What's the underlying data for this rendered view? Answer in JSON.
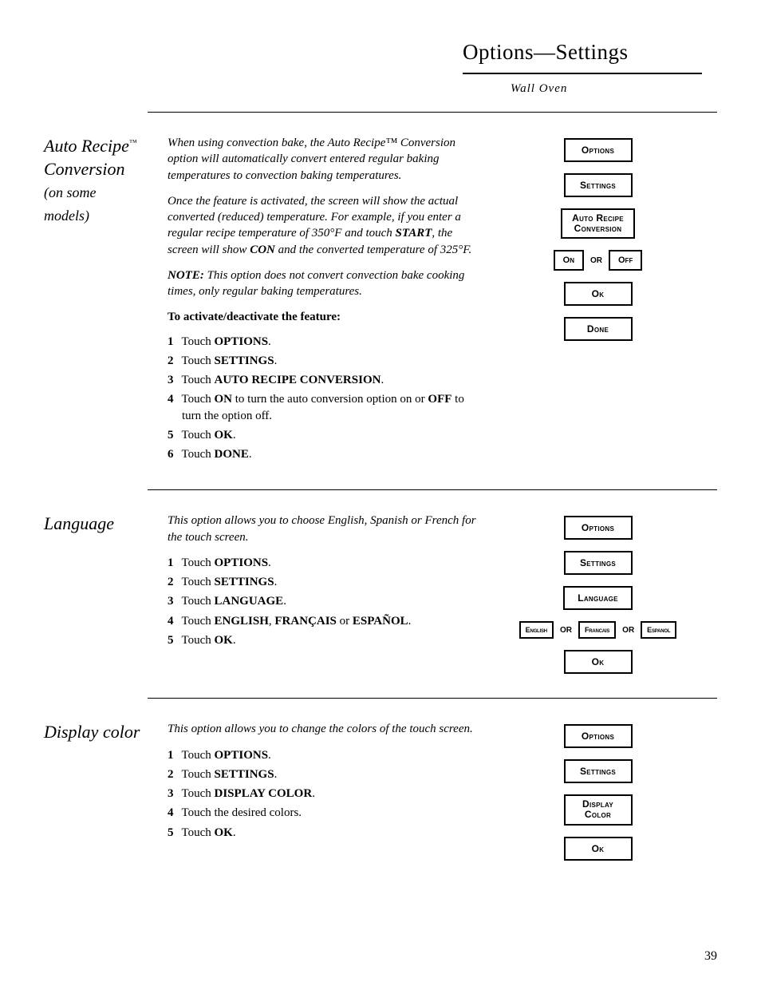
{
  "header": {
    "title": "Options—Settings",
    "subtitle": "Wall Oven"
  },
  "page_number": 39,
  "labels": {
    "options": "Options",
    "settings": "Settings",
    "ok": "Ok",
    "done": "Done",
    "or": "or",
    "auto_recipe_line1": "Auto Recipe",
    "auto_recipe_line2": "Conversion",
    "on": "On",
    "off": "Off",
    "language": "Language",
    "english": "English",
    "francais": "Francais",
    "espanol": "Espanol",
    "display_line1": "Display",
    "display_line2": "Color"
  },
  "section1": {
    "title_l1": "Auto Recipe",
    "title_tm": "™",
    "title_l2": "Conversion",
    "title_l3": "(on some",
    "title_l4": "models)",
    "p1": "When using convection bake, the Auto Recipe™ Conversion option will automatically convert entered regular baking temperatures to convection baking temperatures.",
    "p2a": "Once the feature is activated, the screen will show the actual converted (reduced) temperature. For example, if you enter a regular recipe temperature of 350°F and touch ",
    "p2b": "START",
    "p2c": ", the screen will show ",
    "p2d": "CON",
    "p2e": " and the converted temperature of 325°F.",
    "p3a": "NOTE:",
    "p3b": " This option does not convert convection bake cooking times, only regular baking temperatures.",
    "activate": "To activate/deactivate the feature:",
    "steps": {
      "s1a": "Touch ",
      "s1b": "OPTIONS",
      "s1c": ".",
      "s2a": "Touch ",
      "s2b": "SETTINGS",
      "s2c": ".",
      "s3a": "Touch ",
      "s3b": "AUTO RECIPE CONVERSION",
      "s3c": ".",
      "s4a": "Touch ",
      "s4b": "ON",
      "s4c": " to turn the auto conversion option on or ",
      "s4d": "OFF",
      "s4e": " to turn the option off.",
      "s5a": "Touch ",
      "s5b": "OK",
      "s5c": ".",
      "s6a": "Touch ",
      "s6b": "DONE",
      "s6c": "."
    }
  },
  "section2": {
    "title": "Language",
    "p1": "This option allows you to choose English, Spanish or French for the touch screen.",
    "steps": {
      "s1a": "Touch ",
      "s1b": "OPTIONS",
      "s1c": ".",
      "s2a": "Touch ",
      "s2b": "SETTINGS",
      "s2c": ".",
      "s3a": "Touch ",
      "s3b": "LANGUAGE",
      "s3c": ".",
      "s4a": "Touch ",
      "s4b": "ENGLISH",
      "s4c": ", ",
      "s4d": "FRANÇAIS",
      "s4e": " or ",
      "s4f": "ESPAÑOL",
      "s4g": ".",
      "s5a": "Touch ",
      "s5b": "OK",
      "s5c": "."
    }
  },
  "section3": {
    "title": "Display color",
    "p1": "This option allows you to change the colors of the touch screen.",
    "steps": {
      "s1a": "Touch ",
      "s1b": "OPTIONS",
      "s1c": ".",
      "s2a": "Touch ",
      "s2b": "SETTINGS",
      "s2c": ".",
      "s3a": "Touch ",
      "s3b": "DISPLAY COLOR",
      "s3c": ".",
      "s4a": "Touch the desired colors.",
      "s5a": "Touch ",
      "s5b": "OK",
      "s5c": "."
    }
  }
}
